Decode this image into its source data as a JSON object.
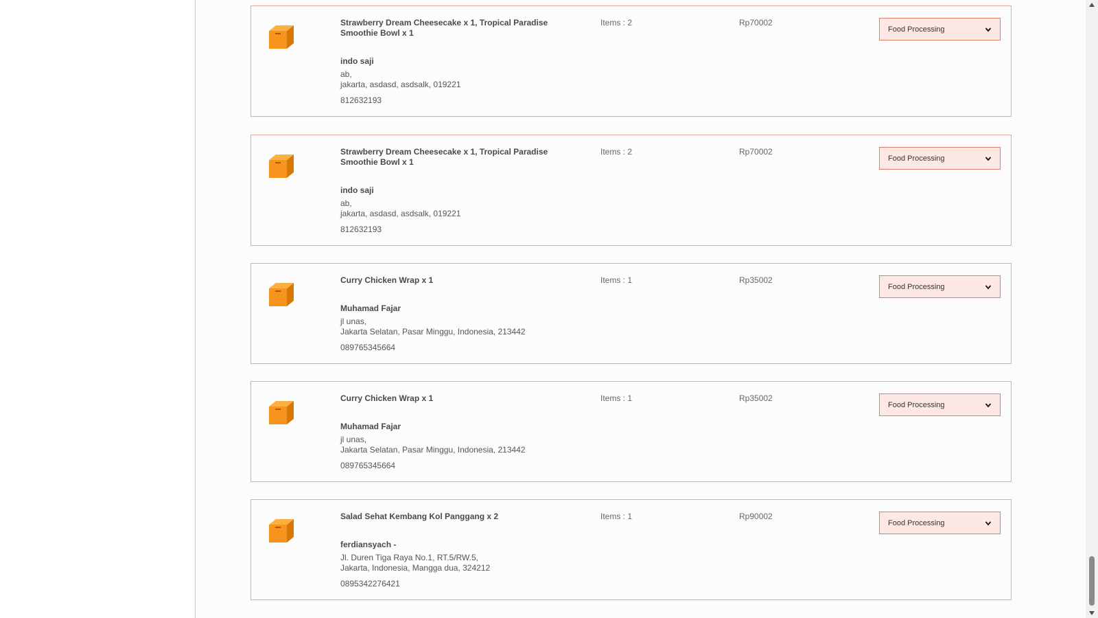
{
  "orders": [
    {
      "products": "Strawberry Dream Cheesecake x 1, Tropical Paradise Smoothie Bowl x 1",
      "customer_name": "indo saji",
      "address_line1": "ab,",
      "address_line2": "jakarta, asdasd, asdsalk, 019221",
      "phone": "812632193",
      "items": "Items : 2",
      "price": "Rp70002",
      "status": "Food Processing"
    },
    {
      "products": "Strawberry Dream Cheesecake x 1, Tropical Paradise Smoothie Bowl x 1",
      "customer_name": "indo saji",
      "address_line1": "ab,",
      "address_line2": "jakarta, asdasd, asdsalk, 019221",
      "phone": "812632193",
      "items": "Items : 2",
      "price": "Rp70002",
      "status": "Food Processing"
    },
    {
      "products": "Curry Chicken Wrap x 1",
      "customer_name": "Muhamad Fajar",
      "address_line1": "jl unas,",
      "address_line2": "Jakarta Selatan, Pasar Minggu, Indonesia, 213442",
      "phone": "089765345664",
      "items": "Items : 1",
      "price": "Rp35002",
      "status": "Food Processing"
    },
    {
      "products": "Curry Chicken Wrap x 1",
      "customer_name": "Muhamad Fajar",
      "address_line1": "jl unas,",
      "address_line2": "Jakarta Selatan, Pasar Minggu, Indonesia, 213442",
      "phone": "089765345664",
      "items": "Items : 1",
      "price": "Rp35002",
      "status": "Food Processing"
    },
    {
      "products": "Salad Sehat Kembang Kol Panggang x 2",
      "customer_name": "ferdiansyach -",
      "address_line1": "Jl. Duren Tiga Raya No.1, RT.5/RW.5,",
      "address_line2": "Jakarta, Indonesia, Mangga dua, 324212",
      "phone": "0895342276421",
      "items": "Items : 1",
      "price": "Rp90002",
      "status": "Food Processing"
    }
  ],
  "icons": {
    "order": "parcel-box-icon",
    "dropdown": "chevron-down-icon",
    "scroll_up": "scroll-up-arrow-icon",
    "scroll_down": "scroll-down-arrow-icon"
  },
  "colors": {
    "card_border": "#e8a798",
    "select_bg": "#fde8e4",
    "select_border": "#e07d6a",
    "box_orange": "#f59b1c"
  }
}
